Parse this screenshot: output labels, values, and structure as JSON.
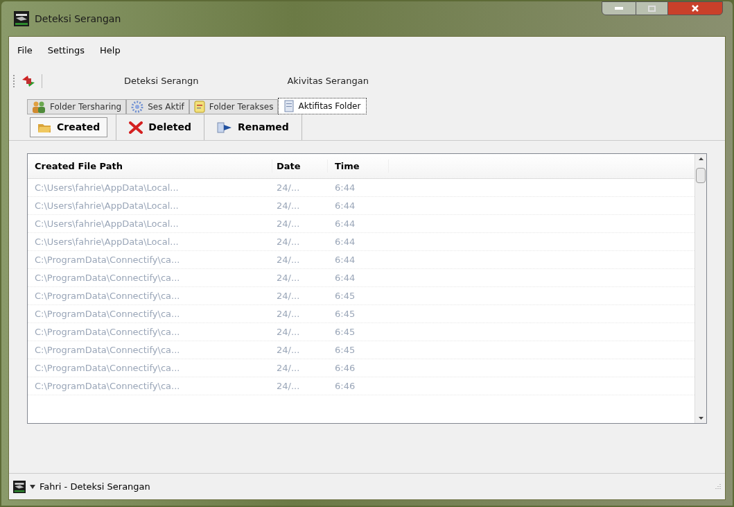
{
  "window": {
    "title": "Deteksi Serangan"
  },
  "menu": [
    "File",
    "Settings",
    "Help"
  ],
  "toolbar": {
    "labels": [
      "Deteksi Serangn",
      "Akivitas Serangan"
    ]
  },
  "tabs": [
    {
      "label": "Folder Tersharing",
      "selected": false
    },
    {
      "label": "Ses Aktif",
      "selected": false
    },
    {
      "label": "Folder Terakses",
      "selected": false
    },
    {
      "label": "Aktifitas Folder",
      "selected": true
    }
  ],
  "subtabs": [
    {
      "label": "Created",
      "selected": true
    },
    {
      "label": "Deleted",
      "selected": false
    },
    {
      "label": "Renamed",
      "selected": false
    }
  ],
  "table": {
    "columns": [
      "Created File Path",
      "Date",
      "Time"
    ],
    "rows": [
      [
        "C:\\Users\\fahrie\\AppData\\Local...",
        "24/...",
        "6:44"
      ],
      [
        "C:\\Users\\fahrie\\AppData\\Local...",
        "24/...",
        "6:44"
      ],
      [
        "C:\\Users\\fahrie\\AppData\\Local...",
        "24/...",
        "6:44"
      ],
      [
        "C:\\Users\\fahrie\\AppData\\Local...",
        "24/...",
        "6:44"
      ],
      [
        "C:\\ProgramData\\Connectify\\ca...",
        "24/...",
        "6:44"
      ],
      [
        "C:\\ProgramData\\Connectify\\ca...",
        "24/...",
        "6:44"
      ],
      [
        "C:\\ProgramData\\Connectify\\ca...",
        "24/...",
        "6:45"
      ],
      [
        "C:\\ProgramData\\Connectify\\ca...",
        "24/...",
        "6:45"
      ],
      [
        "C:\\ProgramData\\Connectify\\ca...",
        "24/...",
        "6:45"
      ],
      [
        "C:\\ProgramData\\Connectify\\ca...",
        "24/...",
        "6:45"
      ],
      [
        "C:\\ProgramData\\Connectify\\ca...",
        "24/...",
        "6:46"
      ],
      [
        "C:\\ProgramData\\Connectify\\ca...",
        "24/...",
        "6:46"
      ]
    ]
  },
  "status_bar": {
    "text": "Fahri - Deteksi Serangan"
  }
}
